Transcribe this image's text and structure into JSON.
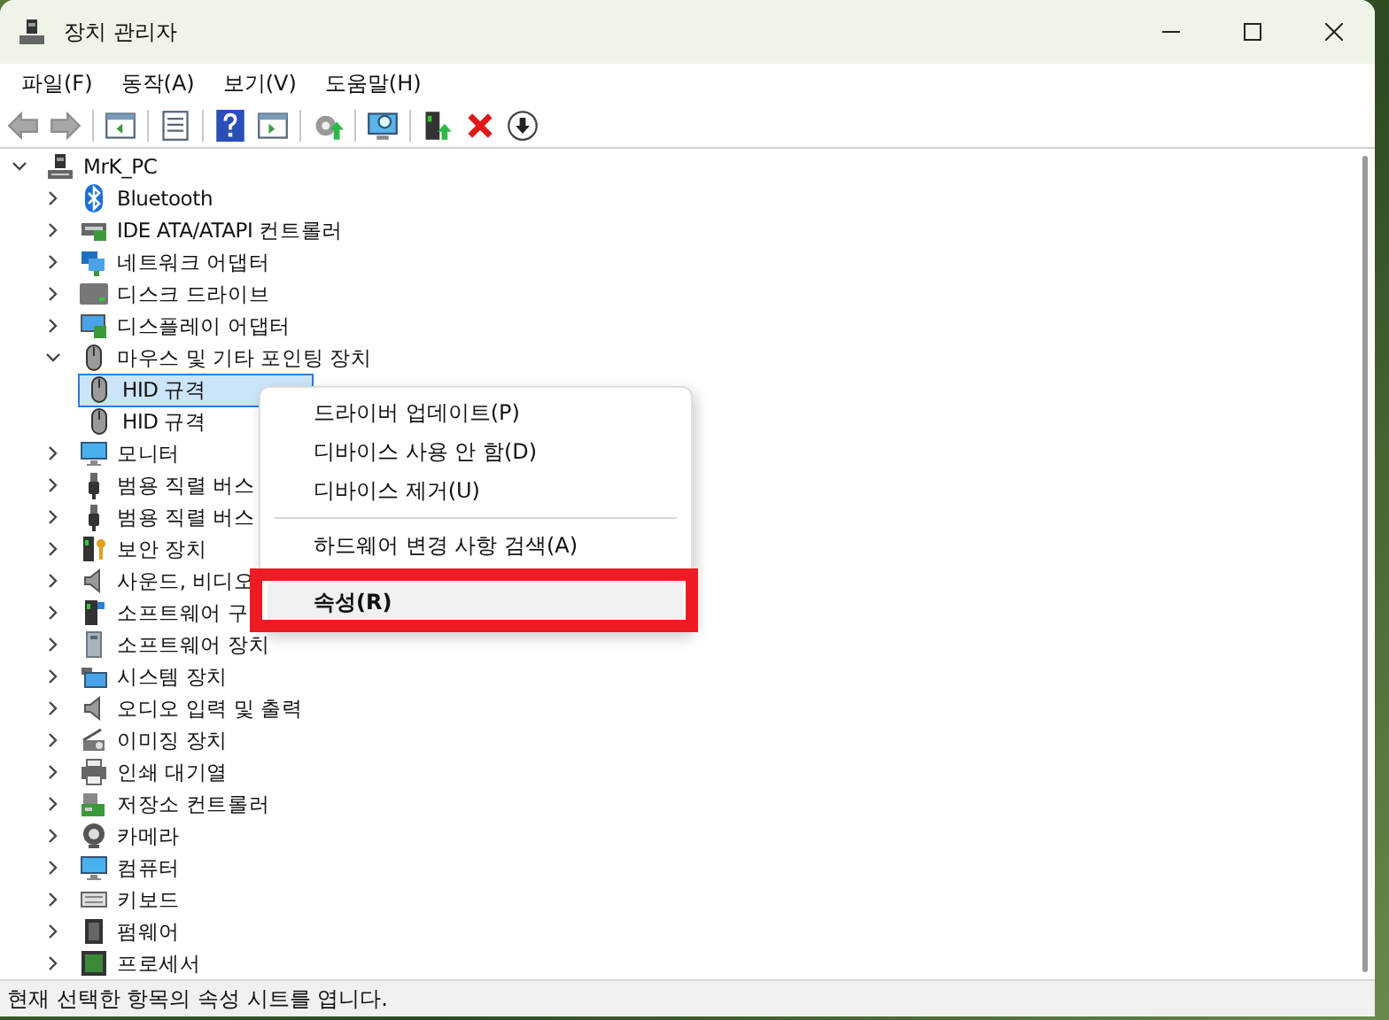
{
  "window": {
    "title": "장치 관리자"
  },
  "menu_bar": [
    "파일(F)",
    "동작(A)",
    "보기(V)",
    "도움말(H)"
  ],
  "toolbar": [
    {
      "kind": "back",
      "disabled": true
    },
    {
      "kind": "forward",
      "disabled": true
    },
    {
      "kind": "separator"
    },
    {
      "kind": "tree-pane",
      "disabled": false
    },
    {
      "kind": "separator"
    },
    {
      "kind": "properties",
      "disabled": false
    },
    {
      "kind": "separator"
    },
    {
      "kind": "help",
      "disabled": false
    },
    {
      "kind": "action-pane",
      "disabled": false
    },
    {
      "kind": "separator"
    },
    {
      "kind": "update",
      "disabled": false
    },
    {
      "kind": "separator"
    },
    {
      "kind": "scan",
      "disabled": false
    },
    {
      "kind": "separator"
    },
    {
      "kind": "enable",
      "disabled": false
    },
    {
      "kind": "remove",
      "disabled": false
    },
    {
      "kind": "disable",
      "disabled": false
    }
  ],
  "tree": {
    "label": "MrK_PC",
    "kind": "pc",
    "expanded": true,
    "selected": false,
    "children": [
      {
        "label": "Bluetooth",
        "kind": "bluetooth",
        "expanded": false,
        "selected": false
      },
      {
        "label": "IDE ATA/ATAPI 컨트롤러",
        "kind": "controller",
        "expanded": false,
        "selected": false
      },
      {
        "label": "네트워크 어댑터",
        "kind": "network",
        "expanded": false,
        "selected": false
      },
      {
        "label": "디스크 드라이브",
        "kind": "disk",
        "expanded": false,
        "selected": false
      },
      {
        "label": "디스플레이 어댑터",
        "kind": "display",
        "expanded": false,
        "selected": false
      },
      {
        "label": "마우스 및 기타 포인팅 장치",
        "kind": "mouse",
        "expanded": true,
        "selected": false,
        "children": [
          {
            "label": "HID 규격",
            "kind": "mouse",
            "selected": true
          },
          {
            "label": "HID 규격",
            "kind": "mouse",
            "selected": false
          }
        ]
      },
      {
        "label": "모니터",
        "kind": "monitor",
        "expanded": false,
        "selected": false
      },
      {
        "label": "범용 직렬 버스",
        "kind": "usb",
        "expanded": false,
        "selected": false
      },
      {
        "label": "범용 직렬 버스",
        "kind": "usb",
        "expanded": false,
        "selected": false
      },
      {
        "label": "보안 장치",
        "kind": "security",
        "expanded": false,
        "selected": false
      },
      {
        "label": "사운드, 비디오",
        "kind": "sound",
        "expanded": false,
        "selected": false
      },
      {
        "label": "소프트웨어 구",
        "kind": "softcomp",
        "expanded": false,
        "selected": false
      },
      {
        "label": "소프트웨어 장치",
        "kind": "softdev",
        "expanded": false,
        "selected": false
      },
      {
        "label": "시스템 장치",
        "kind": "system",
        "expanded": false,
        "selected": false
      },
      {
        "label": "오디오 입력 및 출력",
        "kind": "sound",
        "expanded": false,
        "selected": false
      },
      {
        "label": "이미징 장치",
        "kind": "imaging",
        "expanded": false,
        "selected": false
      },
      {
        "label": "인쇄 대기열",
        "kind": "printer",
        "expanded": false,
        "selected": false
      },
      {
        "label": "저장소 컨트롤러",
        "kind": "storage",
        "expanded": false,
        "selected": false
      },
      {
        "label": "카메라",
        "kind": "webcam",
        "expanded": false,
        "selected": false
      },
      {
        "label": "컴퓨터",
        "kind": "monitor",
        "expanded": false,
        "selected": false
      },
      {
        "label": "키보드",
        "kind": "keyboard",
        "expanded": false,
        "selected": false
      },
      {
        "label": "펌웨어",
        "kind": "firmware",
        "expanded": false,
        "selected": false
      },
      {
        "label": "프로세서",
        "kind": "processor",
        "expanded": false,
        "selected": false
      }
    ]
  },
  "context_menu": [
    {
      "kind": "item",
      "label": "드라이버 업데이트(P)",
      "bold": false,
      "highlighted": false,
      "outlined": false
    },
    {
      "kind": "item",
      "label": "디바이스 사용 안 함(D)",
      "bold": false,
      "highlighted": false,
      "outlined": false
    },
    {
      "kind": "item",
      "label": "디바이스 제거(U)",
      "bold": false,
      "highlighted": false,
      "outlined": false
    },
    {
      "kind": "separator"
    },
    {
      "kind": "item",
      "label": "하드웨어 변경 사항 검색(A)",
      "bold": false,
      "highlighted": false,
      "outlined": false
    },
    {
      "kind": "item",
      "label": "속성(R)",
      "bold": true,
      "highlighted": true,
      "outlined": true
    }
  ],
  "status_bar": "현재 선택한 항목의 속성 시트를 엽니다."
}
